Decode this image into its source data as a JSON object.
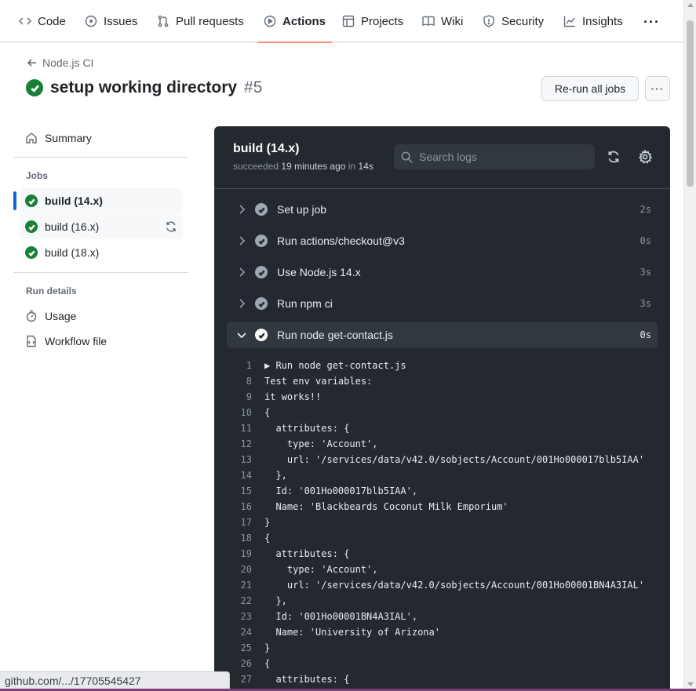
{
  "nav": {
    "tabs": [
      {
        "label": "Code",
        "icon": "code-icon"
      },
      {
        "label": "Issues",
        "icon": "issue-opened-icon"
      },
      {
        "label": "Pull requests",
        "icon": "git-pull-request-icon"
      },
      {
        "label": "Actions",
        "icon": "play-icon",
        "active": true
      },
      {
        "label": "Projects",
        "icon": "table-icon"
      },
      {
        "label": "Wiki",
        "icon": "book-icon"
      },
      {
        "label": "Security",
        "icon": "shield-icon"
      },
      {
        "label": "Insights",
        "icon": "graph-icon"
      }
    ],
    "more": "···"
  },
  "header": {
    "back_label": "Node.js CI",
    "title": "setup working directory",
    "run_number": "#5",
    "rerun_label": "Re-run all jobs",
    "kebab": "···"
  },
  "sidebar": {
    "summary_label": "Summary",
    "jobs_heading": "Jobs",
    "jobs": [
      {
        "label": "build (14.x)",
        "selected": true
      },
      {
        "label": "build (16.x)",
        "hover": true
      },
      {
        "label": "build (18.x)"
      }
    ],
    "run_details_heading": "Run details",
    "usage_label": "Usage",
    "workflow_label": "Workflow file"
  },
  "job": {
    "title": "build (14.x)",
    "status_prefix": "succeeded",
    "status_time": "19 minutes ago",
    "status_in": "in",
    "status_duration": "14s",
    "search_placeholder": "Search logs"
  },
  "steps": [
    {
      "label": "Set up job",
      "duration": "2s"
    },
    {
      "label": "Run actions/checkout@v3",
      "duration": "0s"
    },
    {
      "label": "Use Node.js 14.x",
      "duration": "3s"
    },
    {
      "label": "Run npm ci",
      "duration": "3s"
    },
    {
      "label": "Run node get-contact.js",
      "duration": "0s",
      "expanded": true
    }
  ],
  "log_lines": [
    {
      "n": "1",
      "t": "▶ Run node get-contact.js"
    },
    {
      "n": "8",
      "t": "Test env variables:"
    },
    {
      "n": "9",
      "t": "it works!!"
    },
    {
      "n": "10",
      "t": "{"
    },
    {
      "n": "11",
      "t": "  attributes: {"
    },
    {
      "n": "12",
      "t": "    type: 'Account',"
    },
    {
      "n": "13",
      "t": "    url: '/services/data/v42.0/sobjects/Account/001Ho000017blb5IAA'"
    },
    {
      "n": "14",
      "t": "  },"
    },
    {
      "n": "15",
      "t": "  Id: '001Ho000017blb5IAA',"
    },
    {
      "n": "16",
      "t": "  Name: 'Blackbeards Coconut Milk Emporium'"
    },
    {
      "n": "17",
      "t": "}"
    },
    {
      "n": "18",
      "t": "{"
    },
    {
      "n": "19",
      "t": "  attributes: {"
    },
    {
      "n": "20",
      "t": "    type: 'Account',"
    },
    {
      "n": "21",
      "t": "    url: '/services/data/v42.0/sobjects/Account/001Ho00001BN4A3IAL'"
    },
    {
      "n": "22",
      "t": "  },"
    },
    {
      "n": "23",
      "t": "  Id: '001Ho00001BN4A3IAL',"
    },
    {
      "n": "24",
      "t": "  Name: 'University of Arizona'"
    },
    {
      "n": "25",
      "t": "}"
    },
    {
      "n": "26",
      "t": "{"
    },
    {
      "n": "27",
      "t": "  attributes: {"
    }
  ],
  "status_url": "github.com/.../17705545427",
  "colors": {
    "success": "#1a7f37",
    "accent": "#0969da",
    "active_tab": "#fd8c73",
    "log_bg": "#24292f"
  }
}
